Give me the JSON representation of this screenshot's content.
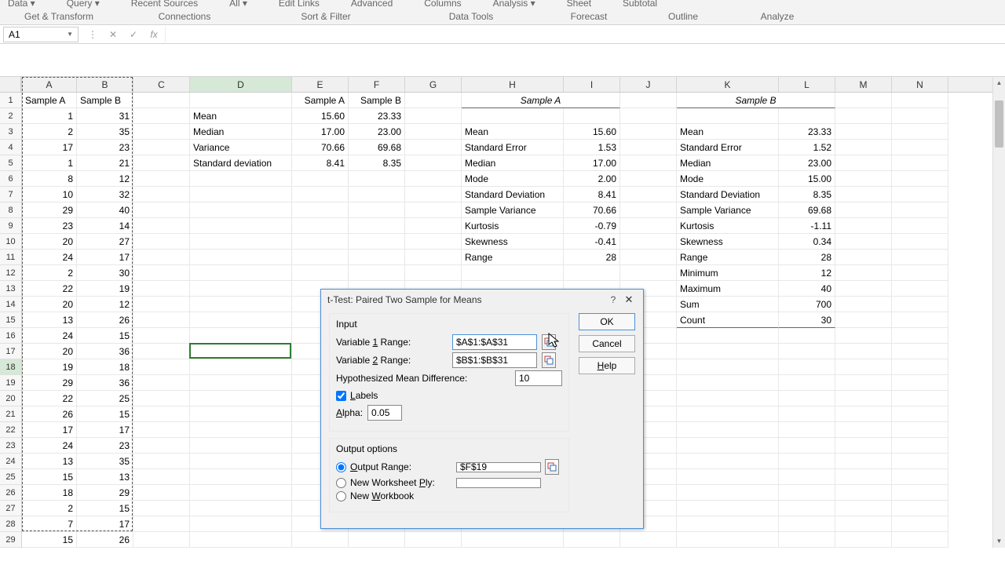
{
  "ribbon": {
    "items": [
      "Data ▾",
      "Query ▾",
      "Recent Sources",
      "All ▾",
      "Edit Links",
      "Advanced",
      "Columns",
      "Analysis ▾",
      "Sheet",
      "Subtotal"
    ],
    "groups": [
      {
        "label": "Get & Transform",
        "w": 150
      },
      {
        "label": "Connections",
        "w": 170
      },
      {
        "label": "Sort & Filter",
        "w": 190
      },
      {
        "label": "Data Tools",
        "w": 180
      },
      {
        "label": "Forecast",
        "w": 120
      },
      {
        "label": "Outline",
        "w": 120
      },
      {
        "label": "Analyze",
        "w": 120
      }
    ]
  },
  "namebox": "A1",
  "columns": [
    {
      "l": "A",
      "w": 70
    },
    {
      "l": "B",
      "w": 72
    },
    {
      "l": "C",
      "w": 72
    },
    {
      "l": "D",
      "w": 130
    },
    {
      "l": "E",
      "w": 72
    },
    {
      "l": "F",
      "w": 72
    },
    {
      "l": "G",
      "w": 72
    },
    {
      "l": "H",
      "w": 130
    },
    {
      "l": "I",
      "w": 72
    },
    {
      "l": "J",
      "w": 72
    },
    {
      "l": "K",
      "w": 130
    },
    {
      "l": "L",
      "w": 72
    },
    {
      "l": "M",
      "w": 72
    },
    {
      "l": "N",
      "w": 72
    }
  ],
  "row_count": 29,
  "selected_row": 18,
  "selected_col_idx": 3,
  "header_row": {
    "A": "Sample A",
    "B": "Sample B",
    "E": "Sample A",
    "F": "Sample B",
    "H_ic": "Sample A",
    "K_ic": "Sample B"
  },
  "hk_underline_rows": [
    1,
    16
  ],
  "data_ab": [
    [
      1,
      31
    ],
    [
      2,
      35
    ],
    [
      17,
      23
    ],
    [
      1,
      21
    ],
    [
      8,
      12
    ],
    [
      10,
      32
    ],
    [
      29,
      40
    ],
    [
      23,
      14
    ],
    [
      20,
      27
    ],
    [
      24,
      17
    ],
    [
      2,
      30
    ],
    [
      22,
      19
    ],
    [
      20,
      12
    ],
    [
      13,
      26
    ],
    [
      24,
      15
    ],
    [
      20,
      36
    ],
    [
      19,
      18
    ],
    [
      29,
      36
    ],
    [
      22,
      25
    ],
    [
      26,
      15
    ],
    [
      17,
      17
    ],
    [
      24,
      23
    ],
    [
      13,
      35
    ],
    [
      15,
      13
    ],
    [
      18,
      29
    ],
    [
      2,
      15
    ],
    [
      7,
      17
    ],
    [
      15,
      26
    ]
  ],
  "stats_de": [
    {
      "d": "Mean",
      "e": "15.60",
      "f": "23.33"
    },
    {
      "d": "Median",
      "e": "17.00",
      "f": "23.00"
    },
    {
      "d": "Variance",
      "e": "70.66",
      "f": "69.68"
    },
    {
      "d": "Standard deviation",
      "e": "8.41",
      "f": "8.35"
    }
  ],
  "stats_hi": [
    {
      "h": "Mean",
      "i": "15.60"
    },
    {
      "h": "Standard Error",
      "i": "1.53"
    },
    {
      "h": "Median",
      "i": "17.00"
    },
    {
      "h": "Mode",
      "i": "2.00"
    },
    {
      "h": "Standard Deviation",
      "i": "8.41"
    },
    {
      "h": "Sample Variance",
      "i": "70.66"
    },
    {
      "h": "Kurtosis",
      "i": "-0.79"
    },
    {
      "h": "Skewness",
      "i": "-0.41"
    },
    {
      "h": "Range",
      "i": "28"
    }
  ],
  "stats_kl": [
    {
      "k": "Mean",
      "l": "23.33"
    },
    {
      "k": "Standard Error",
      "l": "1.52"
    },
    {
      "k": "Median",
      "l": "23.00"
    },
    {
      "k": "Mode",
      "l": "15.00"
    },
    {
      "k": "Standard Deviation",
      "l": "8.35"
    },
    {
      "k": "Sample Variance",
      "l": "69.68"
    },
    {
      "k": "Kurtosis",
      "l": "-1.11"
    },
    {
      "k": "Skewness",
      "l": "0.34"
    },
    {
      "k": "Range",
      "l": "28"
    },
    {
      "k": "Minimum",
      "l": "12"
    },
    {
      "k": "Maximum",
      "l": "40"
    },
    {
      "k": "Sum",
      "l": "700"
    },
    {
      "k": "Count",
      "l": "30"
    }
  ],
  "dialog": {
    "title": "t-Test: Paired Two Sample for Means",
    "input_label": "Input",
    "var1_label_pre": "Variable ",
    "var1_u": "1",
    "var1_label_post": " Range:",
    "var2_label_pre": "Variable ",
    "var2_u": "2",
    "var2_label_post": " Range:",
    "var1_value": "$A$1:$A$31",
    "var2_value": "$B$1:$B$31",
    "hypo_label": "Hypothesized Mean Difference:",
    "hypo_value": "10",
    "labels_u": "L",
    "labels_rest": "abels",
    "alpha_u": "A",
    "alpha_rest": "lpha:",
    "alpha_value": "0.05",
    "output_label": "Output options",
    "out_u": "O",
    "out_rest": "utput Range:",
    "out_value": "$F$19",
    "ply_pre": "New Worksheet ",
    "ply_u": "P",
    "ply_post": "ly:",
    "wb_pre": "New ",
    "wb_u": "W",
    "wb_post": "orkbook",
    "ok": "OK",
    "cancel": "Cancel",
    "help_u": "H",
    "help_rest": "elp"
  }
}
